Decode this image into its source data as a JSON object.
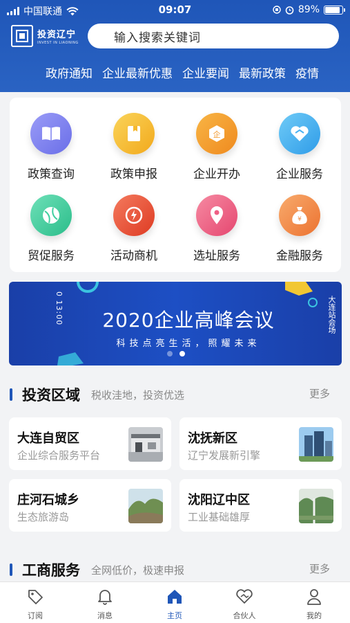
{
  "status": {
    "carrier": "中国联通",
    "time": "09:07",
    "battery": "89%"
  },
  "header": {
    "logo_title": "投资辽宁",
    "logo_sub": "INVEST IN LIAONING",
    "search_placeholder": "输入搜索关键词",
    "nav": [
      "政府通知",
      "企业最新优惠",
      "企业要闻",
      "最新政策",
      "疫情"
    ]
  },
  "services": [
    {
      "label": "政策查询",
      "icon": "book-icon",
      "color": "#7b7ff0"
    },
    {
      "label": "政策申报",
      "icon": "document-icon",
      "color": "#f5b82e"
    },
    {
      "label": "企业开办",
      "icon": "enterprise-icon",
      "color": "#f29a2e"
    },
    {
      "label": "企业服务",
      "icon": "heart-icon",
      "color": "#4ab2f2"
    },
    {
      "label": "贸促服务",
      "icon": "ball-icon",
      "color": "#3fcf9f"
    },
    {
      "label": "活动商机",
      "icon": "lightning-icon",
      "color": "#ec5a3e"
    },
    {
      "label": "选址服务",
      "icon": "location-icon",
      "color": "#ef6085"
    },
    {
      "label": "金融服务",
      "icon": "money-bag-icon",
      "color": "#f28c46"
    }
  ],
  "banner": {
    "title": "2020企业高峰会议",
    "subtitle": "科技点亮生活，照耀未来",
    "date": "0 13:00",
    "side": "大连站会场",
    "page_index": 2,
    "page_count": 2
  },
  "invest": {
    "title": "投资区域",
    "desc": "税收洼地，投资优选",
    "more": "更多",
    "items": [
      {
        "name": "大连自贸区",
        "desc": "企业综合服务平台"
      },
      {
        "name": "沈抚新区",
        "desc": "辽宁发展新引擎"
      },
      {
        "name": "庄河石城乡",
        "desc": "生态旅游岛"
      },
      {
        "name": "沈阳辽中区",
        "desc": "工业基础雄厚"
      }
    ]
  },
  "business": {
    "title": "工商服务",
    "desc": "全网低价，极速申报",
    "more": "更多"
  },
  "tabs": [
    {
      "label": "订阅",
      "icon": "tag-icon"
    },
    {
      "label": "消息",
      "icon": "bell-icon"
    },
    {
      "label": "主页",
      "icon": "home-icon",
      "active": true
    },
    {
      "label": "合伙人",
      "icon": "handshake-icon"
    },
    {
      "label": "我的",
      "icon": "user-icon"
    }
  ],
  "colors": {
    "primary": "#1f56b8",
    "active_tab": "#1f56b8"
  }
}
